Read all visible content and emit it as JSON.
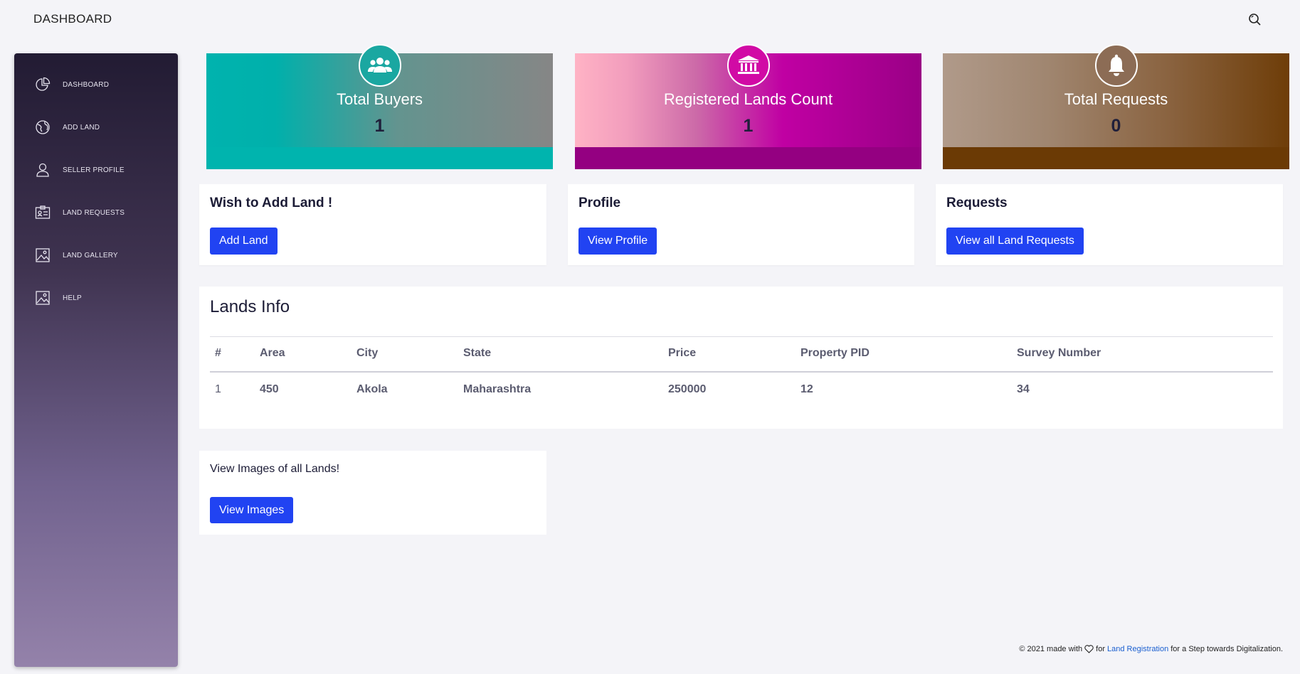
{
  "header": {
    "title": "DASHBOARD",
    "search_icon": "search-icon"
  },
  "sidebar": {
    "items": [
      {
        "label": "DASHBOARD",
        "icon": "pie-chart-icon"
      },
      {
        "label": "ADD LAND",
        "icon": "globe-icon"
      },
      {
        "label": "SELLER PROFILE",
        "icon": "user-icon"
      },
      {
        "label": "LAND REQUESTS",
        "icon": "id-card-icon"
      },
      {
        "label": "LAND GALLERY",
        "icon": "image-icon"
      },
      {
        "label": "HELP",
        "icon": "image-icon"
      }
    ]
  },
  "stats": [
    {
      "title": "Total Buyers",
      "value": "1",
      "icon": "users-icon"
    },
    {
      "title": "Registered Lands Count",
      "value": "1",
      "icon": "bank-icon"
    },
    {
      "title": "Total Requests",
      "value": "0",
      "icon": "bell-icon"
    }
  ],
  "actions": [
    {
      "title": "Wish to Add Land !",
      "button": "Add Land"
    },
    {
      "title": "Profile",
      "button": "View Profile"
    },
    {
      "title": "Requests",
      "button": "View all Land Requests"
    }
  ],
  "lands": {
    "title": "Lands Info",
    "columns": [
      "#",
      "Area",
      "City",
      "State",
      "Price",
      "Property PID",
      "Survey Number"
    ],
    "rows": [
      [
        "1",
        "450",
        "Akola",
        "Maharashtra",
        "250000",
        "12",
        "34"
      ]
    ]
  },
  "images": {
    "text": "View Images of all Lands!",
    "button": "View Images"
  },
  "footer": {
    "prefix": "© 2021 made with",
    "middle": "for",
    "link": "Land Registration",
    "suffix": "for a Step towards Digitalization."
  },
  "colors": {
    "primary_button": "#2143f2",
    "buyers": "#00b4ae",
    "lands": "#940081",
    "requests": "#6b3a05"
  }
}
